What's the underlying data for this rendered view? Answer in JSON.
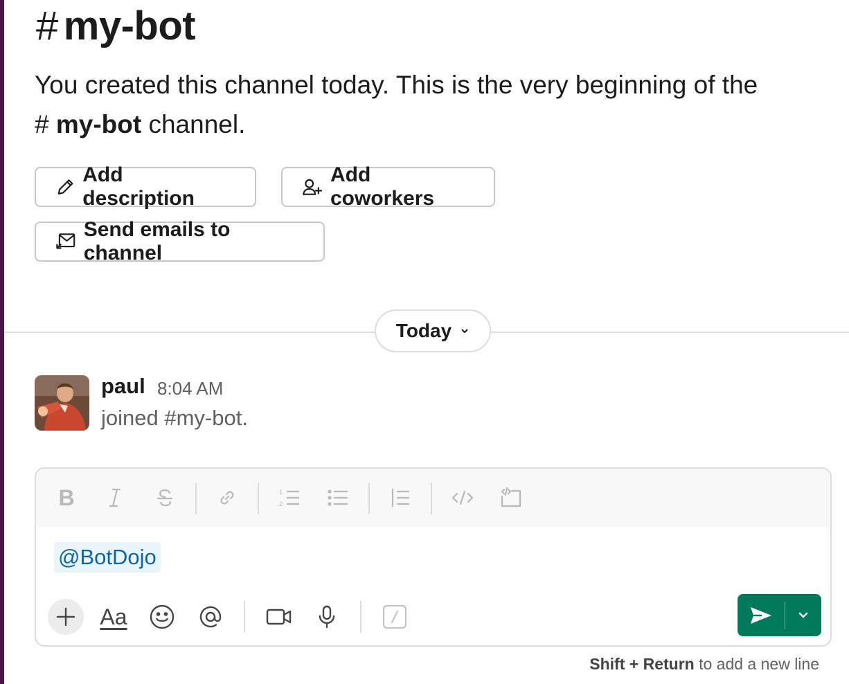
{
  "channel": {
    "hash": "#",
    "name": "my-bot"
  },
  "intro": {
    "text": "You created this channel today. This is the very beginning of the",
    "channel_hash": "#",
    "channel_name": "my-bot",
    "suffix": " channel."
  },
  "actions": {
    "add_description": "Add description",
    "add_coworkers": "Add coworkers",
    "send_emails": "Send emails to channel"
  },
  "divider": {
    "date_label": "Today"
  },
  "message": {
    "author": "paul",
    "time": "8:04 AM",
    "text": "joined #my-bot."
  },
  "composer": {
    "mention": "@BotDojo",
    "toolbar_icons": [
      "bold-icon",
      "italic-icon",
      "strikethrough-icon",
      "link-icon",
      "ordered-list-icon",
      "bulleted-list-icon",
      "blockquote-icon",
      "code-icon",
      "code-block-icon"
    ],
    "bottom_icons": [
      "plus-icon",
      "formatting-icon",
      "emoji-icon",
      "mention-icon",
      "video-icon",
      "microphone-icon",
      "slash-command-icon"
    ],
    "formatting_label": "Aa",
    "hint_bold1": "Shift",
    "hint_plus": " + ",
    "hint_bold2": "Return",
    "hint_rest": " to add a new line"
  },
  "colors": {
    "accent": "#007a5a",
    "sidebar": "#4a154b",
    "mention_text": "#1264a3",
    "mention_bg": "#e8f5fa"
  }
}
